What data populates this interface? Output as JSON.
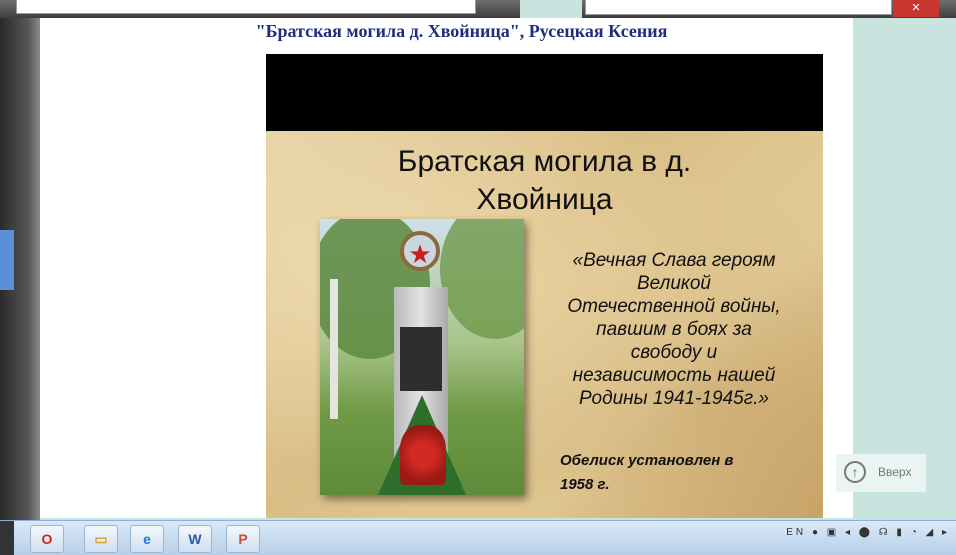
{
  "browser": {
    "address_text": "",
    "close_label": "✕"
  },
  "page": {
    "title": "\"Братская могила д. Хвойница\", Русецкая Ксения"
  },
  "slide": {
    "title_line1": "Братская могила в д.",
    "title_line2": "Хвойница",
    "quote_lines": [
      "«Вечная Слава героям",
      "Великой",
      "Отечественной войны,",
      "павшим в боях за",
      "свободу и",
      "независимость нашей",
      "Родины 1941-1945г.»"
    ],
    "note_line1": "Обелиск установлен в",
    "note_line2": "1958 г."
  },
  "scroll_up": {
    "label": "Вверх",
    "icon": "arrow-up-circle-icon"
  },
  "taskbar": {
    "apps": [
      {
        "name": "opera-icon",
        "glyph": "O",
        "color": "#d2241c"
      },
      {
        "name": "explorer-folder-icon",
        "glyph": "▭",
        "color": "#d4a23a"
      },
      {
        "name": "internet-explorer-icon",
        "glyph": "e",
        "color": "#2a78d0"
      },
      {
        "name": "word-icon",
        "glyph": "W",
        "color": "#2a5aa8"
      },
      {
        "name": "powerpoint-icon",
        "glyph": "P",
        "color": "#c8532a"
      }
    ],
    "tray_lang": "EN",
    "tray_icons": "● ▣ ◂ ⬤ ☊ ▮ ◔ ◢ ▸"
  }
}
